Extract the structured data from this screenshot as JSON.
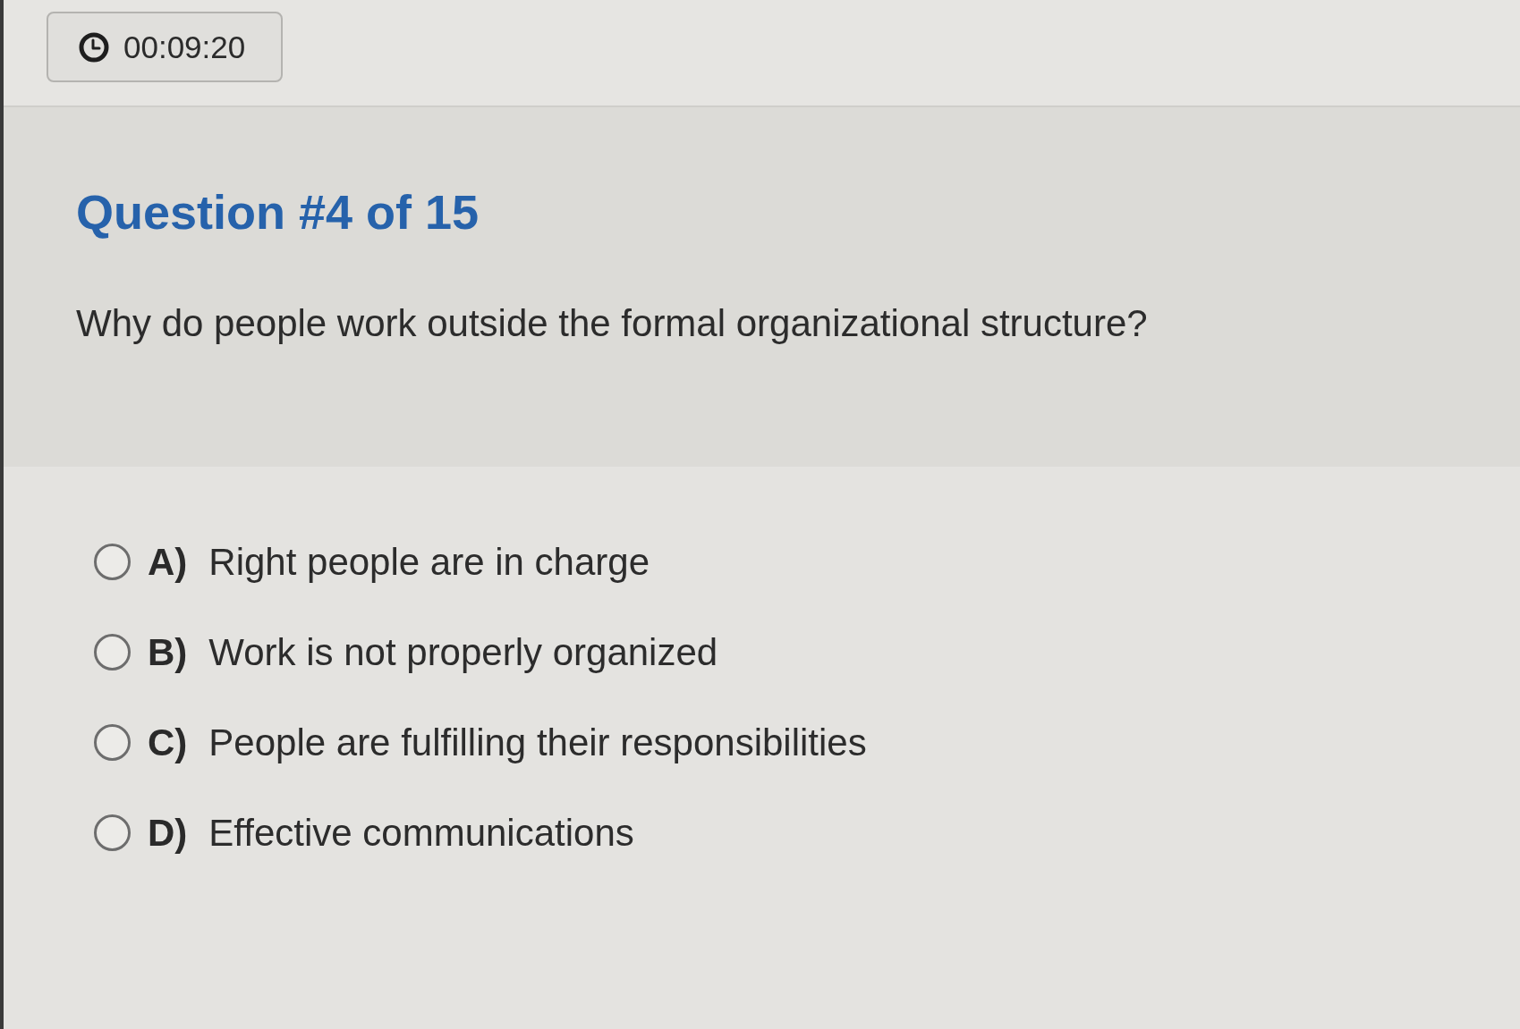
{
  "timer": {
    "time": "00:09:20"
  },
  "question": {
    "title": "Question #4 of 15",
    "text": "Why do people work outside the formal organizational structure?"
  },
  "options": [
    {
      "letter": "A)",
      "text": "Right people are in charge",
      "selected": false
    },
    {
      "letter": "B)",
      "text": "Work is not properly organized",
      "selected": false
    },
    {
      "letter": "C)",
      "text": "People are fulfilling their responsibilities",
      "selected": false
    },
    {
      "letter": "D)",
      "text": "Effective communications",
      "selected": false
    }
  ]
}
